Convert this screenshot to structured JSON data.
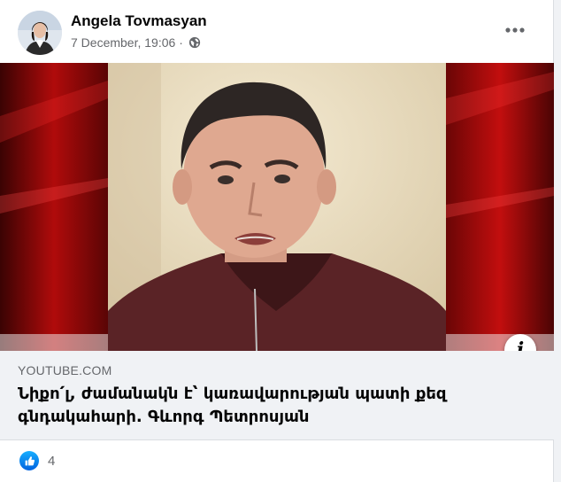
{
  "post": {
    "author": "Angela Tovmasyan",
    "timestamp": "7 December, 19:06",
    "separator": "·",
    "privacy_icon": "globe-icon",
    "more_icon": "more-options-icon"
  },
  "video": {
    "info_label": "i"
  },
  "link_preview": {
    "domain": "YOUTUBE.COM",
    "title": "Նիքո՛լ, ժամանակն է՝ կառավարության պատի քեզ գնդակահարի. Գևորգ Պետրոսյան"
  },
  "reactions": {
    "icon": "like-icon",
    "count": "4"
  },
  "colors": {
    "accent": "#1877f2",
    "secondary_text": "#65676b",
    "link_bg": "#f0f2f5"
  }
}
